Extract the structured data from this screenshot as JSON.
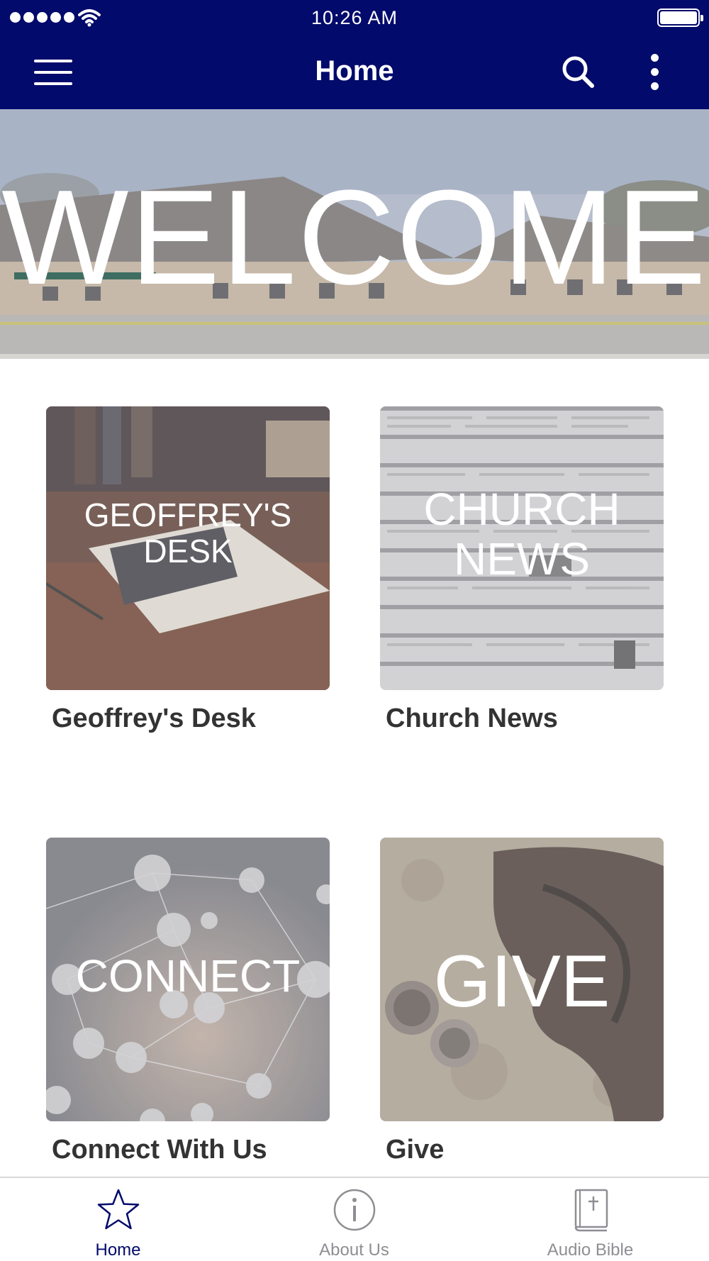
{
  "status_bar": {
    "time": "10:26 AM"
  },
  "header": {
    "title": "Home"
  },
  "banner": {
    "text": "WELCOME"
  },
  "tiles": [
    {
      "image_text_line1": "GEOFFREY'S",
      "image_text_line2": "DESK",
      "caption": "Geoffrey's Desk"
    },
    {
      "image_text_line1": "CHURCH",
      "image_text_line2": "NEWS",
      "caption": "Church News"
    },
    {
      "image_text_line1": "CONNECT",
      "caption": "Connect With Us"
    },
    {
      "image_text_line1": "GIVE",
      "caption": "Give"
    }
  ],
  "tabbar": {
    "items": [
      {
        "label": "Home",
        "icon": "star-icon",
        "active": true
      },
      {
        "label": "About Us",
        "icon": "info-icon",
        "active": false
      },
      {
        "label": "Audio Bible",
        "icon": "bible-icon",
        "active": false
      }
    ]
  },
  "colors": {
    "nav": "#020a6b",
    "caption": "#333333",
    "inactive_tab": "#8e8e93"
  }
}
